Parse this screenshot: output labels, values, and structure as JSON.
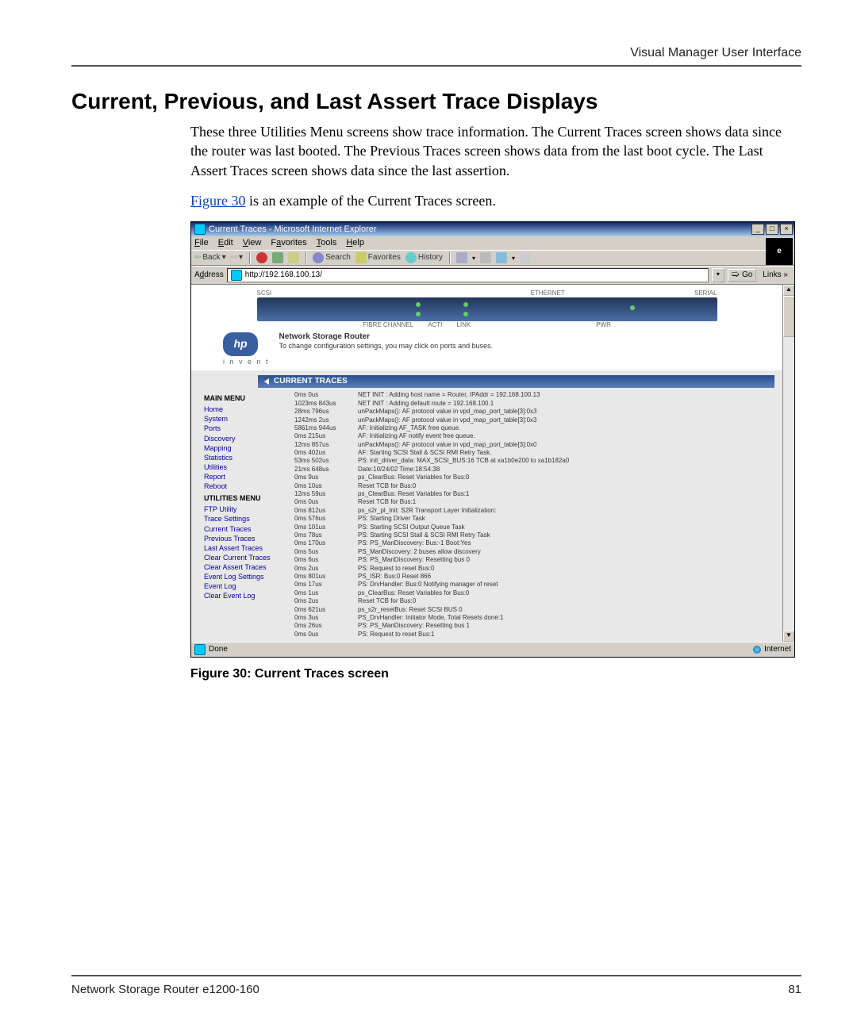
{
  "header_right": "Visual Manager User Interface",
  "heading": "Current, Previous, and Last Assert Trace Displays",
  "para1": "These three Utilities Menu screens show trace information. The Current Traces screen shows data since the router was last booted. The Previous Traces screen shows data from the last boot cycle. The Last Assert Traces screen shows data since the last assertion.",
  "figref": "Figure 30",
  "para2_rest": " is an example of the Current Traces screen.",
  "caption": "Figure 30:  Current Traces screen",
  "footer_left": "Network Storage Router e1200-160",
  "footer_right": "81",
  "ie": {
    "title": "Current Traces - Microsoft Internet Explorer",
    "menu": [
      "File",
      "Edit",
      "View",
      "Favorites",
      "Tools",
      "Help"
    ],
    "toolbar_back": "Back",
    "toolbar_search": "Search",
    "toolbar_fav": "Favorites",
    "toolbar_hist": "History",
    "addr_label": "Address",
    "addr_value": "http://192.168.100.13/",
    "go": "Go",
    "links": "Links",
    "router_ports": {
      "scsi": "SCSI",
      "eth": "ETHERNET",
      "serial": "SERIAL",
      "fibre": "FIBRE CHANNEL",
      "acti": "ACTI",
      "link": "LINK",
      "pwr": "PWR"
    },
    "router_name": "Network Storage Router",
    "router_desc": "To change configuration settings, you may click on ports and buses.",
    "hp_invent": "i n v e n t",
    "ct_title": "CURRENT TRACES",
    "main_menu_hdr": "MAIN MENU",
    "main_menu": [
      "Home",
      "System",
      "Ports",
      "Discovery",
      "Mapping",
      "Statistics",
      "Utilities",
      "Report",
      "Reboot"
    ],
    "util_menu_hdr": "UTILITIES MENU",
    "util_menu": [
      "FTP Utility",
      "Trace Settings",
      "Current Traces",
      "Previous Traces",
      "Last Assert Traces",
      "Clear Current Traces",
      "Clear Assert Traces",
      "Event Log Settings",
      "Event Log",
      "Clear Event Log"
    ],
    "trace_times": [
      "0ms 0us",
      "1023ms 843us",
      "28ms 796us",
      "1242ms 2us",
      "5861ms 944us",
      "0ms 215us",
      "12ms 857us",
      "0ms 402us",
      "53ms 502us",
      "21ms 648us",
      "0ms 9us",
      "0ms 10us",
      "12ms 59us",
      "0ms 0us",
      "0ms 812us",
      "0ms 576us",
      "0ms 101us",
      "0ms 78us",
      "0ms 170us",
      "0ms 5us",
      "0ms 6us",
      "0ms 2us",
      "0ms 801us",
      "0ms 17us",
      "0ms 1us",
      "0ms 2us",
      "0ms 621us",
      "0ms 3us",
      "0ms 26us",
      "0ms 0us"
    ],
    "trace_msgs": [
      "NET INIT : Adding host name = Router, IPAddr = 192.168.100.13",
      "NET INIT : Adding default route = 192.168.100.1",
      "unPackMaps(): AF protocol value in vpd_map_port_table[3]:0x3",
      "unPackMaps(): AF protocol value in vpd_map_port_table[3]:0x3",
      "AF: Initializing AF_TASK free queue.",
      "AF: Initializing AF notify event free queue.",
      "unPackMaps(): AF protocol value in vpd_map_port_table[3]:0x0",
      "AF: Starting SCSI Stall & SCSI RMI Retry Task.",
      "PS: init_driver_data: MAX_SCSI_BUS:16 TCB at xa1b0e200 to xa1b182a0",
      "Date:10/24/02 Time:18:54:38",
      "ps_ClearBus: Reset Variables for Bus:0",
      "Reset TCB for Bus:0",
      "ps_ClearBus: Reset Variables for Bus:1",
      "Reset TCB for Bus:1",
      "ps_s2r_pl_Init: S2R Transport Layer Initialization:",
      "PS: Starting Driver Task",
      "PS: Starting SCSI Output Queue Task",
      "PS: Starting SCSI Stall & SCSI RMI Retry Task",
      "PS: PS_ManDiscovery: Bus:-1 Boot:Yes",
      "PS_ManDiscovery: 2 buses allow discovery",
      "PS: PS_ManDiscovery: Resetting bus 0",
      "PS: Request to reset Bus:0",
      "PS_ISR: Bus:0 Reset 866",
      "PS: DrvHandler: Bus:0 Notifying manager of reset",
      "ps_ClearBus: Reset Variables for Bus:0",
      "Reset TCB for Bus:0",
      "ps_s2r_resetBus: Reset SCSI BUS 0",
      "PS_DrvHandler: Initiator Mode, Total Resets done:1",
      "PS: PS_ManDiscovery: Resetting bus 1",
      "PS: Request to reset Bus:1"
    ],
    "status_left": "Done",
    "status_right": "Internet"
  }
}
